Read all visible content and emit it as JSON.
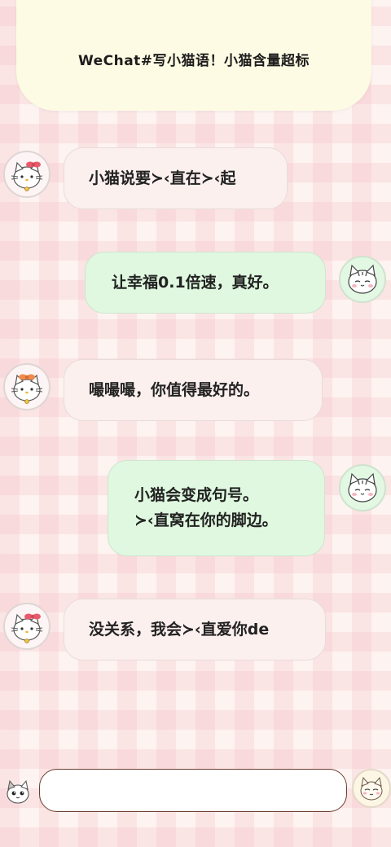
{
  "header": {
    "title": "WeChat#写小猫语！小猫含量超标"
  },
  "messages": [
    {
      "side": "left",
      "lines": [
        "小猫说要≻‹直在≻‹起"
      ]
    },
    {
      "side": "right",
      "lines": [
        "让幸福0.1倍速，真好。"
      ]
    },
    {
      "side": "left",
      "lines": [
        "嘬嘬嘬，你值得最好的。"
      ]
    },
    {
      "side": "right",
      "lines": [
        "小猫会变成句号。",
        "≻‹直窝在你的脚边。"
      ]
    },
    {
      "side": "left",
      "lines": [
        "没关系，我会≻‹直爱你de"
      ]
    }
  ],
  "input": {
    "value": "",
    "placeholder": ""
  },
  "icons": {
    "left_avatar": "hello-kitty-bow-cat-icon",
    "right_avatar": "tabby-cat-icon",
    "small_cat": "small-cat-icon",
    "send_avatar": "cream-cat-icon"
  },
  "colors": {
    "header_bg": "#fdfbe3",
    "left_bubble": "#fcf0ee",
    "right_bubble": "#dff8df",
    "input_border": "#6b3d2f",
    "bow": "#e85a6a"
  }
}
